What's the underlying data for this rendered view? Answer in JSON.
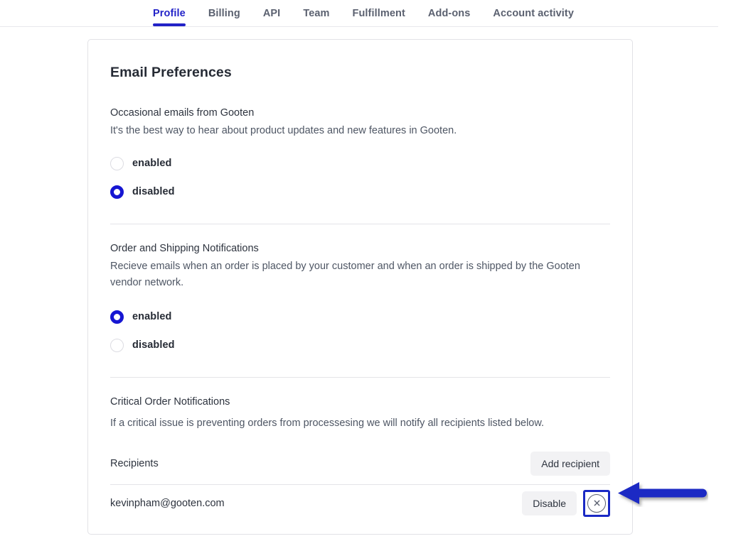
{
  "nav": {
    "tabs": [
      {
        "label": "Profile",
        "active": true
      },
      {
        "label": "Billing",
        "active": false
      },
      {
        "label": "API",
        "active": false
      },
      {
        "label": "Team",
        "active": false
      },
      {
        "label": "Fulfillment",
        "active": false
      },
      {
        "label": "Add-ons",
        "active": false
      },
      {
        "label": "Account activity",
        "active": false
      }
    ]
  },
  "card": {
    "title": "Email Preferences",
    "sections": [
      {
        "heading": "Occasional emails from Gooten",
        "description": "It's the best way to hear about product updates and new features in Gooten.",
        "options": [
          {
            "label": "enabled",
            "selected": false
          },
          {
            "label": "disabled",
            "selected": true
          }
        ]
      },
      {
        "heading": "Order and Shipping Notifications",
        "description": "Recieve emails when an order is placed by your customer and when an order is shipped by the Gooten vendor network.",
        "options": [
          {
            "label": "enabled",
            "selected": true
          },
          {
            "label": "disabled",
            "selected": false
          }
        ]
      }
    ],
    "critical": {
      "heading": "Critical Order Notifications",
      "description": "If a critical issue is preventing orders from processesing we will notify all recipients listed below.",
      "recipients_label": "Recipients",
      "add_recipient_label": "Add recipient",
      "rows": [
        {
          "email": "kevinpham@gooten.com",
          "disable_label": "Disable",
          "remove_icon": "circle-x-icon"
        }
      ]
    }
  },
  "annotation": {
    "arrow": "left-pointing-arrow",
    "highlight_color": "#1a29c4"
  },
  "colors": {
    "accent": "#2222c7",
    "radio_checked": "#1616d2",
    "text_primary": "#262b35",
    "text_secondary": "#4e5664",
    "button_gray": "#f2f2f4",
    "border": "#e2e2e6"
  }
}
